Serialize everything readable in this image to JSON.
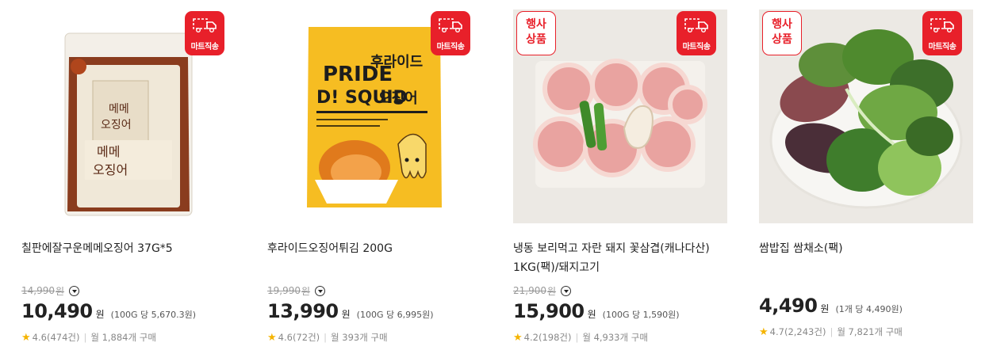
{
  "colors": {
    "accent": "#e8202a",
    "star": "#f5b400"
  },
  "badges": {
    "mart": "마트직송",
    "event_line1": "행사",
    "event_line2": "상품"
  },
  "products": [
    {
      "title_line1": "칠판에잘구운메메오징어 37G*5",
      "title_line2": "",
      "original_price": "14,990",
      "original_unit": "원",
      "price": "10,490",
      "currency": "원",
      "unit_price": "(100G 당 5,670.3원)",
      "rating": "4.6",
      "reviews": "(474건)",
      "sales": "월 1,884개 구매",
      "event": false
    },
    {
      "title_line1": "후라이드오징어튀김 200G",
      "title_line2": "",
      "original_price": "19,990",
      "original_unit": "원",
      "price": "13,990",
      "currency": "원",
      "unit_price": "(100G 당 6,995원)",
      "rating": "4.6",
      "reviews": "(72건)",
      "sales": "월 393개 구매",
      "event": false,
      "pkg_text": {
        "line1": "PRIDE",
        "line2": "D! SQUID",
        "kr1": "후라이드",
        "kr2": "오징어"
      }
    },
    {
      "title_line1": "냉동 보리먹고 자란 돼지 꽃삼겹(캐나다산)",
      "title_line2": "1KG(팩)/돼지고기",
      "original_price": "21,900",
      "original_unit": "원",
      "price": "15,900",
      "currency": "원",
      "unit_price": "(100G 당 1,590원)",
      "rating": "4.2",
      "reviews": "(198건)",
      "sales": "월 4,933개 구매",
      "event": true
    },
    {
      "title_line1": "쌈밥집 쌈채소(팩)",
      "title_line2": "",
      "original_price": "",
      "original_unit": "",
      "price": "4,490",
      "currency": "원",
      "unit_price": "(1개 당 4,490원)",
      "rating": "4.7",
      "reviews": "(2,243건)",
      "sales": "월 7,821개 구매",
      "event": true
    }
  ]
}
